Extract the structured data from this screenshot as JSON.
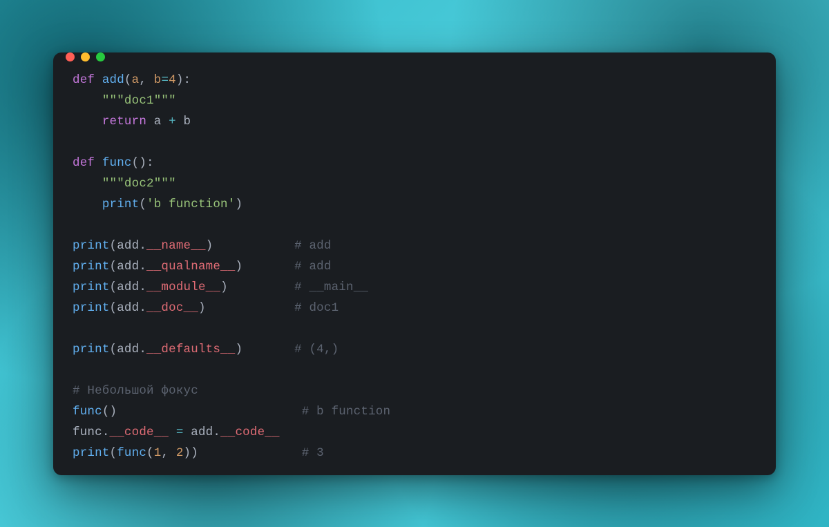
{
  "traffic_lights": [
    "close",
    "minimize",
    "zoom"
  ],
  "code": {
    "l1": {
      "def": "def",
      "sp1": " ",
      "fn": "add",
      "open": "(",
      "p1": "a",
      "c1": ", ",
      "p2": "b",
      "eq": "=",
      "num": "4",
      "close": "):"
    },
    "l2": {
      "indent": "    ",
      "doc": "\"\"\"doc1\"\"\""
    },
    "l3": {
      "indent": "    ",
      "ret": "return",
      "sp": " ",
      "a": "a",
      "sp2": " ",
      "plus": "+",
      "sp3": " ",
      "b": "b"
    },
    "l4": "",
    "l5": {
      "def": "def",
      "sp1": " ",
      "fn": "func",
      "open": "(",
      "close": "):"
    },
    "l6": {
      "indent": "    ",
      "doc": "\"\"\"doc2\"\"\""
    },
    "l7": {
      "indent": "    ",
      "print": "print",
      "open": "(",
      "str": "'b function'",
      "close": ")"
    },
    "l8": "",
    "l9": {
      "print": "print",
      "open": "(",
      "obj": "add",
      "dot": ".",
      "attr": "__name__",
      "close": ")",
      "pad": "           ",
      "cm": "# add"
    },
    "l10": {
      "print": "print",
      "open": "(",
      "obj": "add",
      "dot": ".",
      "attr": "__qualname__",
      "close": ")",
      "pad": "       ",
      "cm": "# add"
    },
    "l11": {
      "print": "print",
      "open": "(",
      "obj": "add",
      "dot": ".",
      "attr": "__module__",
      "close": ")",
      "pad": "         ",
      "cm": "# __main__"
    },
    "l12": {
      "print": "print",
      "open": "(",
      "obj": "add",
      "dot": ".",
      "attr": "__doc__",
      "close": ")",
      "pad": "            ",
      "cm": "# doc1"
    },
    "l13": "",
    "l14": {
      "print": "print",
      "open": "(",
      "obj": "add",
      "dot": ".",
      "attr": "__defaults__",
      "close": ")",
      "pad": "       ",
      "cm": "# (4,)"
    },
    "l15": "",
    "l16": {
      "cm": "# Небольшой фокус"
    },
    "l17": {
      "fn": "func",
      "open": "(",
      "close": ")",
      "pad": "                         ",
      "cm": "# b function"
    },
    "l18": {
      "obj1": "func",
      "dot1": ".",
      "attr1": "__code__",
      "sp1": " ",
      "eq": "=",
      "sp2": " ",
      "obj2": "add",
      "dot2": ".",
      "attr2": "__code__"
    },
    "l19": {
      "print": "print",
      "open": "(",
      "fn": "func",
      "open2": "(",
      "n1": "1",
      "c": ", ",
      "n2": "2",
      "close2": ")",
      "close": ")",
      "pad": "              ",
      "cm": "# 3"
    }
  }
}
